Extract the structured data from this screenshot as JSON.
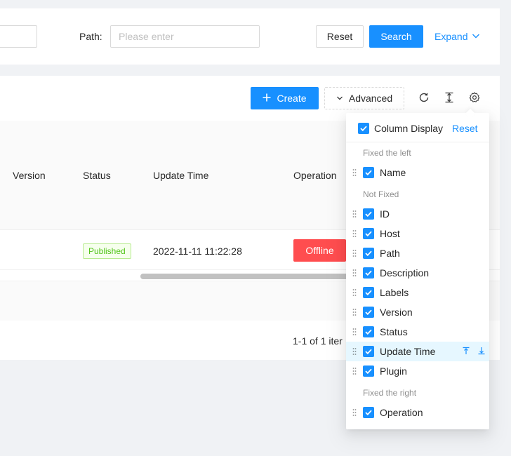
{
  "search": {
    "path_label": "Path:",
    "path_placeholder": "Please enter",
    "reset_label": "Reset",
    "search_label": "Search",
    "expand_label": "Expand"
  },
  "toolbar": {
    "create_label": "Create",
    "advanced_label": "Advanced",
    "icons": [
      "reload-icon",
      "density-icon",
      "setting-icon"
    ]
  },
  "table": {
    "columns": [
      "Version",
      "Status",
      "Update Time",
      "Operation"
    ],
    "rows": [
      {
        "status": "Published",
        "update_time": "2022-11-11 11:22:28",
        "action": "Offline"
      }
    ],
    "pagination_text": "1-1 of 1 iter"
  },
  "column_settings": {
    "title": "Column Display",
    "reset_label": "Reset",
    "groups": [
      {
        "title": "Fixed the left",
        "items": [
          "Name"
        ]
      },
      {
        "title": "Not Fixed",
        "items": [
          "ID",
          "Host",
          "Path",
          "Description",
          "Labels",
          "Version",
          "Status",
          "Update Time",
          "Plugin"
        ]
      },
      {
        "title": "Fixed the right",
        "items": [
          "Operation"
        ]
      }
    ]
  },
  "colors": {
    "primary": "#1890ff",
    "danger": "#ff4d4f",
    "success": "#52c41a",
    "background": "#f0f2f5"
  }
}
